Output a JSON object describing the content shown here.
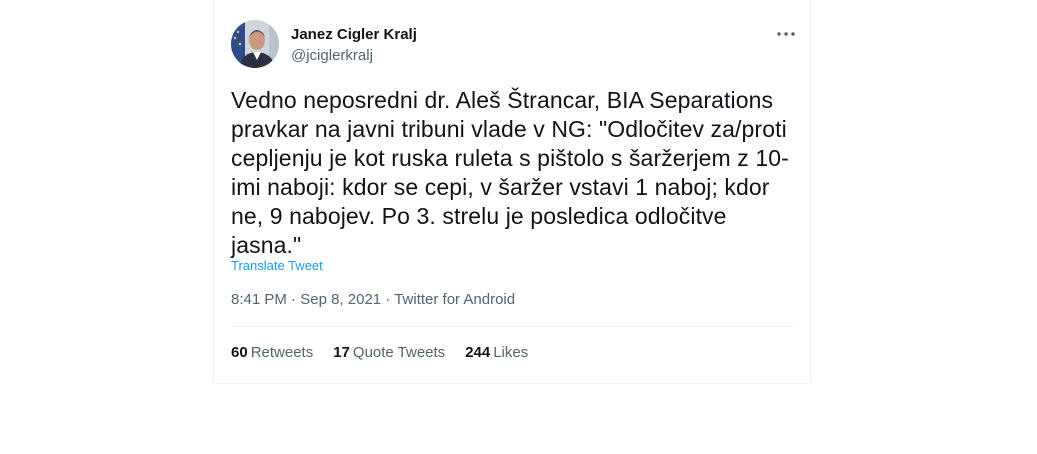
{
  "tweet": {
    "author": {
      "name": "Janez Cigler Kralj",
      "handle": "@jciglerkralj"
    },
    "text": "Vedno neposredni dr. Aleš Štrancar, BIA Separations\npravkar na javni tribuni vlade v NG: \"Odločitev za/proti\ncepljenju je kot ruska ruleta s pištolo s šaržerjem z 10-\nimi naboji: kdor se cepi, v šaržer vstavi 1 naboj; kdor\nne, 9 nabojev. Po 3. strelu je posledica odločitve\njasna.\"",
    "translate_label": "Translate Tweet",
    "time": "8:41 PM",
    "date": "Sep 8, 2021",
    "source": "Twitter for Android",
    "separator": "·",
    "stats": {
      "retweets_count": "60",
      "retweets_label": "Retweets",
      "quotes_count": "17",
      "quotes_label": "Quote Tweets",
      "likes_count": "244",
      "likes_label": "Likes"
    }
  },
  "icons": {
    "more": "more-horizontal-icon"
  },
  "colors": {
    "link": "#1d9bf0",
    "secondary_text": "#536471",
    "primary_text": "#0f1419"
  }
}
